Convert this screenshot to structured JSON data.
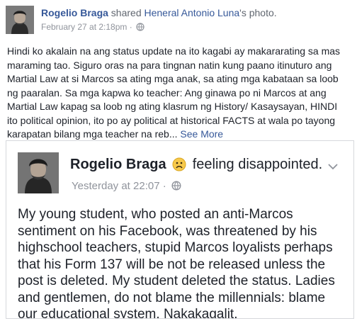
{
  "post": {
    "actor": "Rogelio Braga",
    "verb": "shared",
    "page": "Heneral Antonio Luna",
    "noun": "'s photo.",
    "timestamp": "February 27 at 2:18pm",
    "separator": "·",
    "body": "Hindi ko akalain na ang status update na ito kagabi ay makararating sa mas maraming tao. Siguro oras na para tingnan natin kung paano itinuturo ang Martial Law at si Marcos sa ating mga anak, sa ating mga kabataan sa loob ng paaralan. Sa mga kapwa ko teacher: Ang ginawa po ni Marcos at ang Martial Law kapag sa loob ng ating klasrum ng History/ Kasaysayan, HINDI ito political opinion, ito po ay political at historical FACTS at wala po tayong karapatan bilang mga teacher na reb...",
    "see_more": "See More"
  },
  "shared": {
    "actor": "Rogelio Braga",
    "feeling": "feeling disappointed.",
    "timestamp": "Yesterday at 22:07",
    "separator": "·",
    "text": "My young student, who posted an anti-Marcos sentiment on his Facebook, was threatened by his highschool teachers, stupid Marcos loyalists perhaps that his Form 137 will be not be released unless the post is deleted. My student deleted the status. Ladies and gentlemen, do not blame the millennials: blame our educational system. Nakakagalit."
  },
  "icons": {
    "privacy": "globe-icon",
    "menu": "chevron-down-icon",
    "emotion": "disappointed-face-icon"
  },
  "colors": {
    "link": "#365899",
    "meta": "#90949c",
    "text": "#1d2129"
  }
}
